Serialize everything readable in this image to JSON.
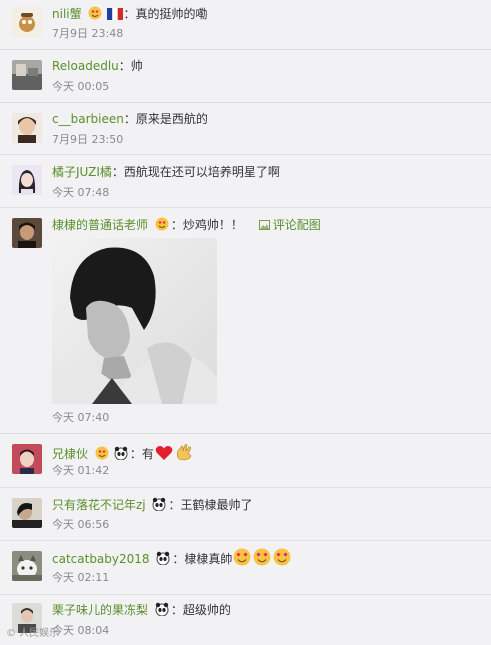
{
  "comments": [
    {
      "user": "nili蟹",
      "colon": "：",
      "text": "真的挺帅的嘞",
      "time": "7月9日 23:48"
    },
    {
      "user": "Reloadedlu",
      "colon": "：",
      "text": "帅",
      "time": "今天 00:05"
    },
    {
      "user": "c__barbieen",
      "colon": "：",
      "text": "原来是西航的",
      "time": "7月9日 23:50"
    },
    {
      "user": "橘子JUZI橘",
      "colon": "：",
      "text": "西航现在还可以培养明星了啊",
      "time": "今天 07:48"
    },
    {
      "user": "棣棣的普通话老师",
      "colon": "：",
      "text": "炒鸡帅！！",
      "time": "今天 07:40",
      "reply_pic_label": "评论配图"
    },
    {
      "user": "兄棣伙",
      "colon": "：",
      "text": "有",
      "time": "今天 01:42"
    },
    {
      "user": "只有落花不记年zj",
      "colon": "：",
      "text": "王鹤棣最帅了",
      "time": "今天 06:56"
    },
    {
      "user": "catcatbaby2018",
      "colon": "：",
      "text": "棣棣真帥",
      "time": "今天 02:11"
    },
    {
      "user": "栗子味儿的果冻梨",
      "colon": "：",
      "text": "超级帅的",
      "time": "今天 08:04"
    }
  ],
  "watermark": "© 人民娱乐",
  "colors": {
    "username": "#5a8f2a",
    "divider": "#dfdfe3",
    "background": "#f2f2f5"
  },
  "icons": [
    "french-flag-icon",
    "panda-icon",
    "heart-icon",
    "ok-hand-icon",
    "heart-eyes-icon",
    "image-icon"
  ]
}
